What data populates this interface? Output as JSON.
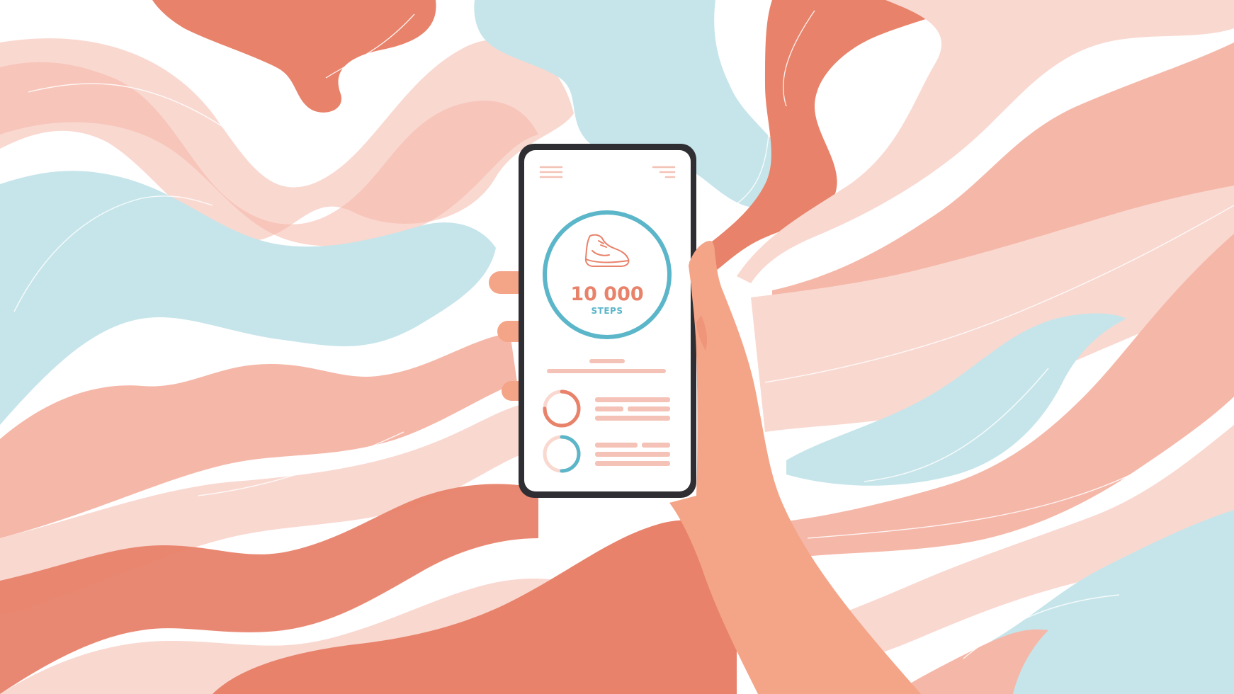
{
  "app": {
    "goal": {
      "count": "10 000",
      "unit": "STEPS",
      "icon": "sneaker-icon"
    },
    "header": {
      "left_icon": "hamburger-menu-icon",
      "right_icon": "settings-lines-icon"
    },
    "list": [
      {
        "icon": "progress-ring-icon",
        "progress": 0.75
      },
      {
        "icon": "progress-ring-icon",
        "progress": 0.5
      }
    ]
  },
  "colors": {
    "background": "#ffffff",
    "terracotta": "#e8826a",
    "peach": "#f5b7a8",
    "light_pink": "#f9d8d0",
    "sky_blue": "#c6e5ea",
    "accent_blue": "#5bb6c9",
    "accent_orange": "#e8826a",
    "skin": "#f4a487",
    "phone_frame": "#2f2f33",
    "screen": "#ffffff",
    "placeholder": "#f4c2b6"
  }
}
